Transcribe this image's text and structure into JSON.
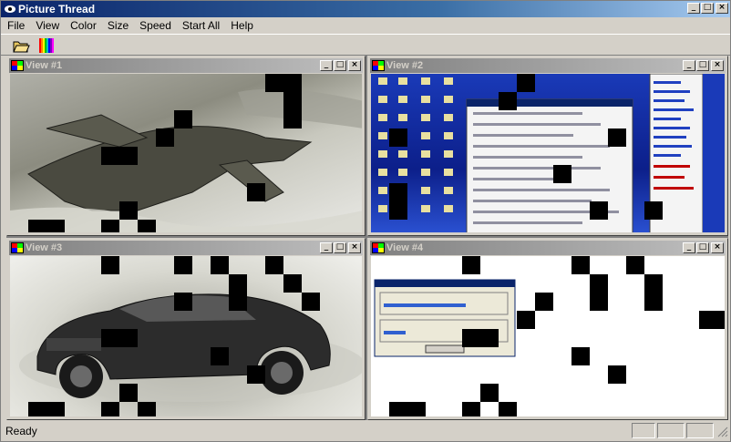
{
  "window": {
    "title": "Picture Thread"
  },
  "menu": {
    "items": [
      "File",
      "View",
      "Color",
      "Size",
      "Speed",
      "Start All",
      "Help"
    ]
  },
  "toolbar": {
    "open_icon": "open-folder-icon",
    "palette_icon": "color-bars-icon"
  },
  "views": [
    {
      "title": "View #1",
      "content": "jet"
    },
    {
      "title": "View #2",
      "content": "desktop"
    },
    {
      "title": "View #3",
      "content": "car"
    },
    {
      "title": "View #4",
      "content": "dialog"
    }
  ],
  "dialog": {
    "title": "",
    "cpu_label": "",
    "cpu_value": "",
    "mem_label": "",
    "mem_value": "",
    "button": ""
  },
  "status": {
    "text": "Ready"
  }
}
